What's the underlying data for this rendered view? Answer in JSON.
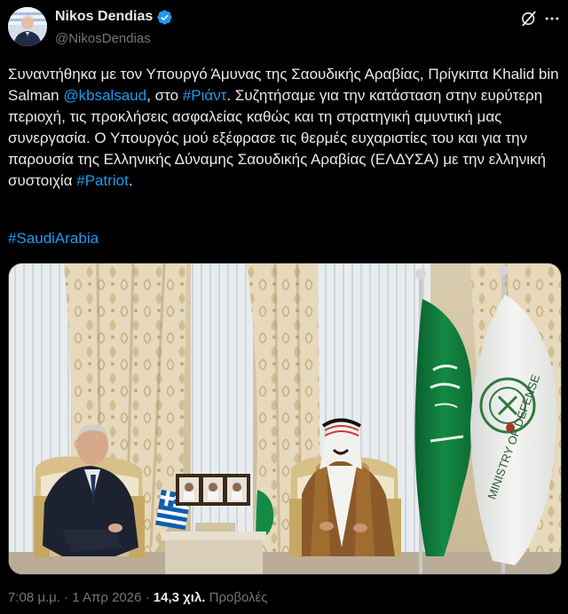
{
  "author": {
    "display_name": "Nikos Dendias",
    "handle": "@NikosDendias",
    "verified": true
  },
  "tweet": {
    "text_segments": [
      {
        "t": "Συναντήθηκα με τον Υπουργό Άμυνας της Σαουδικής Αραβίας, Πρίγκιπα Khalid bin Salman ",
        "link": false
      },
      {
        "t": "@kbsalsaud",
        "link": true
      },
      {
        "t": ", στο ",
        "link": false
      },
      {
        "t": "#Ριάντ",
        "link": true
      },
      {
        "t": ". Συζητήσαμε για την κατάσταση στην ευρύτερη περιοχή, τις προκλήσεις ασφαλείας καθώς και τη στρατηγική αμυντική μας συνεργασία. Ο Υπουργός μού εξέφρασε τις θερμές ευχαριστίες του και για την παρουσία της Ελληνικής Δύναμης Σαουδικής Αραβίας (ΕΛΔΥΣΑ) με την ελληνική συστοιχία ",
        "link": false
      },
      {
        "t": "#Patriot",
        "link": true
      },
      {
        "t": ".",
        "link": false
      }
    ],
    "hashtag": "#SaudiArabia",
    "photo_text": "MINISTRY OF DEFENSE"
  },
  "meta": {
    "time": "7:08 μ.μ.",
    "separator": "·",
    "date": "1 Απρ 2026",
    "views_count": "14,3 χιλ.",
    "views_label": "Προβολές"
  },
  "colors": {
    "background": "#000000",
    "text": "#e7e9ea",
    "secondary": "#71767b",
    "link": "#1d9bf0",
    "verified": "#1d9bf0"
  },
  "icons": {
    "verified": "verified-badge-icon",
    "grok": "grok-icon",
    "more": "more-options-icon"
  }
}
